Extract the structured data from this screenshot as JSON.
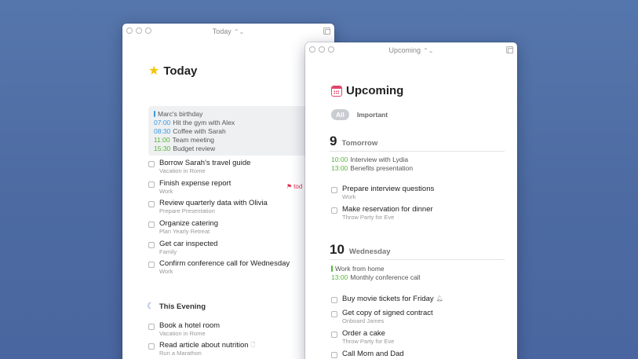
{
  "colors": {
    "green": "#58b535",
    "blue": "#3c9ae0",
    "pink": "#e0456a",
    "red": "#e03050",
    "star": "#f5c400"
  },
  "today_window": {
    "title": "Today",
    "heading": "Today",
    "events": [
      {
        "time": "",
        "label": "Marc's birthday",
        "color": "#3c9ae0"
      },
      {
        "time": "07:00",
        "label": "Hit the gym with Alex",
        "color": "#3c9ae0"
      },
      {
        "time": "08:30",
        "label": "Coffee with Sarah",
        "color": "#3c9ae0"
      },
      {
        "time": "11:00",
        "label": "Team meeting",
        "color": "#58b535"
      },
      {
        "time": "15:30",
        "label": "Budget review",
        "color": "#58b535"
      }
    ],
    "tasks": [
      {
        "title": "Borrow Sarah's travel guide",
        "sub": "Vacation in Rome"
      },
      {
        "title": "Finish expense report",
        "sub": "Work"
      },
      {
        "title": "Review quarterly data with Olivia",
        "sub": "Prepare Presentation"
      },
      {
        "title": "Organize catering",
        "sub": "Plan Yearly Retreat"
      },
      {
        "title": "Get car inspected",
        "sub": "Family"
      },
      {
        "title": "Confirm conference call for Wednesday",
        "sub": "Work"
      }
    ],
    "flag_text": "tod",
    "evening_heading": "This Evening",
    "evening_tasks": [
      {
        "title": "Book a hotel room",
        "sub": "Vacation in Rome"
      },
      {
        "title": "Read article about nutrition",
        "sub": "Run a Marathon"
      }
    ]
  },
  "upcoming_window": {
    "title": "Upcoming",
    "heading": "Upcoming",
    "filters": {
      "all": "All",
      "important": "Important"
    },
    "day1": {
      "num": "9",
      "name": "Tomorrow",
      "events": [
        {
          "time": "10:00",
          "label": "Interview with Lydia",
          "color": "#58b535"
        },
        {
          "time": "13:00",
          "label": "Benefits presentation",
          "color": "#58b535"
        }
      ],
      "tasks": [
        {
          "title": "Prepare interview questions",
          "sub": "Work"
        },
        {
          "title": "Make reservation for dinner",
          "sub": "Throw Party for Eve"
        }
      ]
    },
    "day2": {
      "num": "10",
      "name": "Wednesday",
      "events": [
        {
          "time": "",
          "label": "Work from home",
          "color": "#58b535"
        },
        {
          "time": "13:00",
          "label": "Monthly conference call",
          "color": "#58b535"
        }
      ],
      "tasks": [
        {
          "title": "Buy movie tickets for Friday",
          "sub": ""
        },
        {
          "title": "Get copy of signed contract",
          "sub": "Onboard James"
        },
        {
          "title": "Order a cake",
          "sub": "Throw Party for Eve"
        },
        {
          "title": "Call Mom and Dad",
          "sub": ""
        }
      ]
    }
  }
}
